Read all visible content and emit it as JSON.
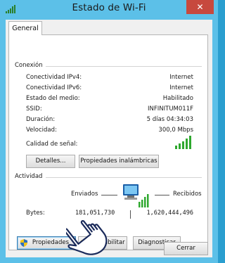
{
  "window": {
    "title": "Estado de Wi-Fi",
    "close_glyph": "✕"
  },
  "tabs": [
    {
      "label": "General"
    }
  ],
  "connection": {
    "group_title": "Conexión",
    "rows": [
      {
        "label": "Conectividad IPv4:",
        "value": "Internet"
      },
      {
        "label": "Conectividad IPv6:",
        "value": "Internet"
      },
      {
        "label": "Estado del medio:",
        "value": "Habilitado"
      },
      {
        "label": "SSID:",
        "value": "INFINITUM011F"
      },
      {
        "label": "Duración:",
        "value": "5 días 04:34:03"
      },
      {
        "label": "Velocidad:",
        "value": "300,0 Mbps"
      }
    ],
    "signal_label": "Calidad de señal:",
    "signal_bars": 5,
    "details_button": "Detalles...",
    "wireless_props_button": "Propiedades inalámbricas"
  },
  "activity": {
    "group_title": "Actividad",
    "sent_label": "Enviados",
    "received_label": "Recibidos",
    "bytes_label": "Bytes:",
    "bytes_sent": "181,051,730",
    "bytes_received": "1,620,444,496"
  },
  "actions": {
    "properties_button": "Propiedades",
    "disable_button": "Deshabilitar",
    "diagnose_button": "Diagnosticar"
  },
  "footer": {
    "close_button": "Cerrar"
  },
  "icons": {
    "title": "wifi-signal-icon",
    "signal": "signal-bars-icon",
    "network": "network-computer-icon",
    "shield": "uac-shield-icon",
    "cursor": "hand-cursor-icon"
  },
  "colors": {
    "title_bar": "#5cc0e8",
    "close_button": "#c7493e",
    "signal_green": "#2fa82f",
    "focus_blue": "#3c7fb1"
  }
}
